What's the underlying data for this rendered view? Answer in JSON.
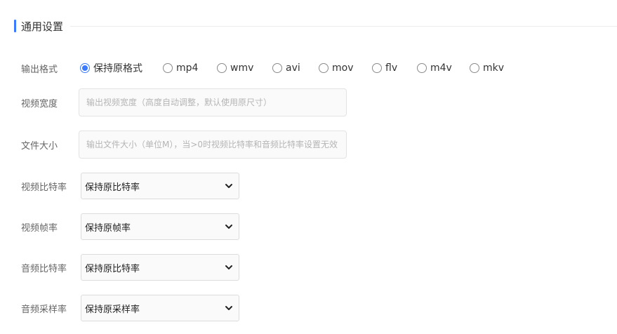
{
  "section": {
    "title": "通用设置",
    "accent_color": "#3a7bff"
  },
  "output_format": {
    "label": "输出格式",
    "selected_index": 0,
    "options": [
      "保持原格式",
      "mp4",
      "wmv",
      "avi",
      "mov",
      "flv",
      "m4v",
      "mkv"
    ]
  },
  "video_width": {
    "label": "视频宽度",
    "value": "",
    "placeholder": "输出视频宽度（高度自动调整，默认使用原尺寸）"
  },
  "file_size": {
    "label": "文件大小",
    "value": "",
    "placeholder": "输出文件大小（单位M），当>0时视频比特率和音频比特率设置无效"
  },
  "video_bitrate": {
    "label": "视频比特率",
    "value": "保持原比特率"
  },
  "video_framerate": {
    "label": "视频帧率",
    "value": "保持原帧率"
  },
  "audio_bitrate": {
    "label": "音频比特率",
    "value": "保持原比特率"
  },
  "audio_samplerate": {
    "label": "音频采样率",
    "value": "保持原采样率"
  }
}
